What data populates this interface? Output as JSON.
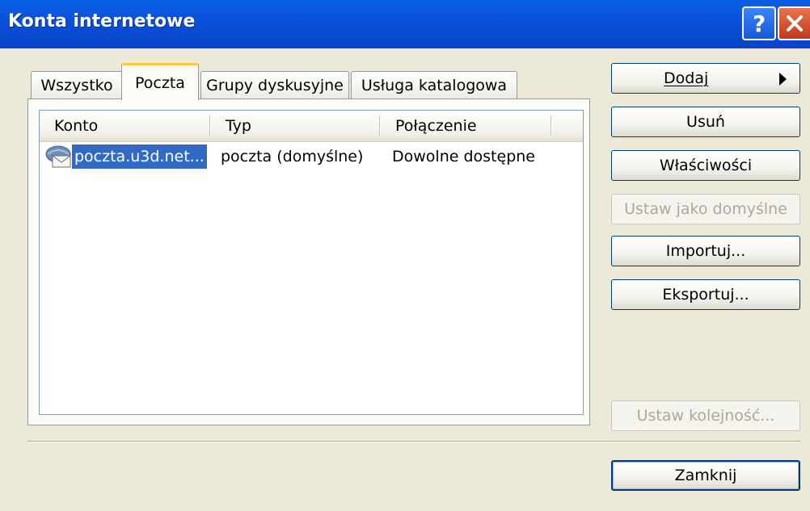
{
  "window": {
    "title": "Konta internetowe"
  },
  "tabs": [
    {
      "label": "Wszystko",
      "active": false
    },
    {
      "label": "Poczta",
      "active": true
    },
    {
      "label": "Grupy dyskusyjne",
      "active": false
    },
    {
      "label": "Usługa katalogowa",
      "active": false
    }
  ],
  "list": {
    "columns": [
      "Konto",
      "Typ",
      "Połączenie"
    ],
    "rows": [
      {
        "konto": "poczta.u3d.net...",
        "typ": "poczta (domyślne)",
        "polaczenie": "Dowolne dostępne",
        "selected": true
      }
    ]
  },
  "buttons": {
    "dodaj": "Dodaj",
    "usun": "Usuń",
    "wlasciwosci": "Właściwości",
    "ustaw_domyslne": "Ustaw jako domyślne",
    "importuj": "Importuj...",
    "eksportuj": "Eksportuj...",
    "ustaw_kolejnosc": "Ustaw kolejność...",
    "zamknij": "Zamknij"
  },
  "icons": {
    "help": "help-icon",
    "close": "close-icon",
    "account": "mail-account-icon",
    "submenu": "arrow-right-icon"
  },
  "colors": {
    "titlebar": "#0a50d8",
    "selection": "#316ac5",
    "active_tab_accent": "#ffc83c",
    "face": "#ece9d8"
  }
}
